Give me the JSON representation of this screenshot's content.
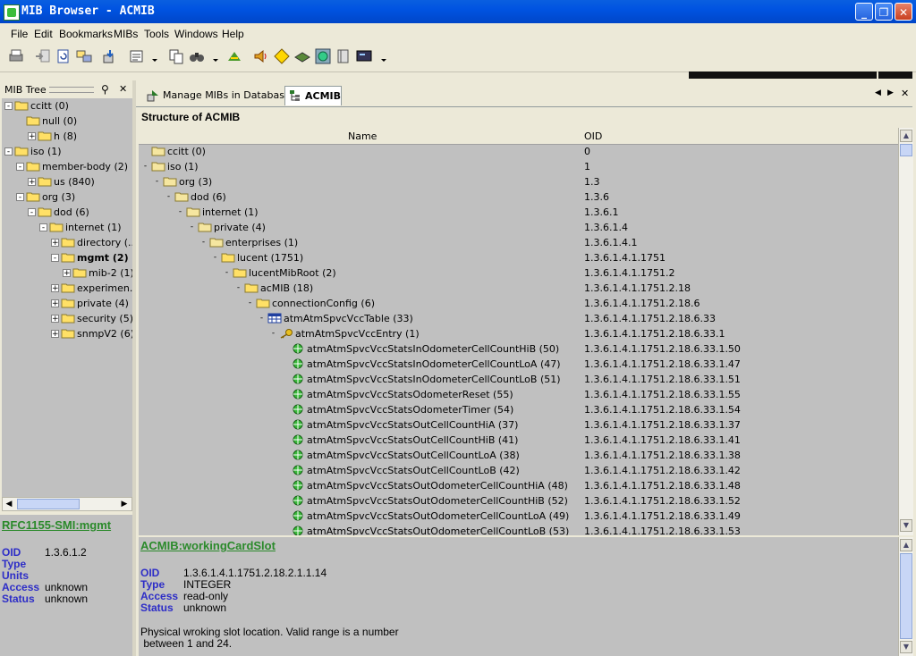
{
  "window": {
    "title": "MIB Browser - ACMIB",
    "minimize": "_",
    "maximize": "❐",
    "close": "✕"
  },
  "menu": [
    "File",
    "Edit",
    "Bookmarks",
    "MIBs",
    "Tools",
    "Windows",
    "Help"
  ],
  "toolbar_icons": [
    "printer-icon",
    "import-icon",
    "refresh-icon",
    "transfer-icon",
    "load-mib-icon",
    "properties-icon",
    "copy-icon",
    "find-icon",
    "walk-icon",
    "sound-icon",
    "tag-icon",
    "device-icon",
    "globe-icon",
    "book-icon",
    "screen-icon"
  ],
  "left": {
    "header": "MIB Tree",
    "pin": "⚲",
    "close": "✕",
    "tree": [
      {
        "label": "ccitt (0)",
        "depth": 0,
        "exp": "-"
      },
      {
        "label": "null (0)",
        "depth": 1,
        "exp": ""
      },
      {
        "label": "h (8)",
        "depth": 2,
        "exp": "+"
      },
      {
        "label": "iso (1)",
        "depth": 0,
        "exp": "-"
      },
      {
        "label": "member-body (2)",
        "depth": 1,
        "exp": "-"
      },
      {
        "label": "us (840)",
        "depth": 2,
        "exp": "+"
      },
      {
        "label": "org (3)",
        "depth": 1,
        "exp": "-"
      },
      {
        "label": "dod (6)",
        "depth": 2,
        "exp": "-"
      },
      {
        "label": "internet (1)",
        "depth": 3,
        "exp": "-"
      },
      {
        "label": "directory (...",
        "depth": 4,
        "exp": "+"
      },
      {
        "label": "mgmt (2)",
        "depth": 4,
        "exp": "-",
        "bold": true
      },
      {
        "label": "mib-2 (1)",
        "depth": 5,
        "exp": "+"
      },
      {
        "label": "experimen...",
        "depth": 4,
        "exp": "+"
      },
      {
        "label": "private (4)",
        "depth": 4,
        "exp": "+"
      },
      {
        "label": "security (5)",
        "depth": 4,
        "exp": "+"
      },
      {
        "label": "snmpV2 (6)",
        "depth": 4,
        "exp": "+"
      }
    ],
    "detail": {
      "title": "RFC1155-SMI:mgmt",
      "oid_label": "OID",
      "oid": "1.3.6.1.2",
      "type_label": "Type",
      "type": "",
      "units_label": "Units",
      "units": "",
      "access_label": "Access",
      "access": "unknown",
      "status_label": "Status",
      "status": "unknown"
    }
  },
  "tabs": [
    {
      "label": "Manage MIBs in Database"
    },
    {
      "label": "ACMIB"
    }
  ],
  "tab_nav": {
    "prev": "◀",
    "next": "▶",
    "close": "✕"
  },
  "structure_title": "Structure of ACMIB",
  "columns": {
    "name": "Name",
    "oid": "OID"
  },
  "rows": [
    {
      "name": "ccitt (0)",
      "oid": "0",
      "depth": 0,
      "icon": "folder",
      "exp": ""
    },
    {
      "name": "iso (1)",
      "oid": "1",
      "depth": 0,
      "icon": "folder",
      "exp": "-"
    },
    {
      "name": "org (3)",
      "oid": "1.3",
      "depth": 1,
      "icon": "folder",
      "exp": "-"
    },
    {
      "name": "dod (6)",
      "oid": "1.3.6",
      "depth": 2,
      "icon": "folder",
      "exp": "-"
    },
    {
      "name": "internet (1)",
      "oid": "1.3.6.1",
      "depth": 3,
      "icon": "folder",
      "exp": "-"
    },
    {
      "name": "private (4)",
      "oid": "1.3.6.1.4",
      "depth": 4,
      "icon": "folder",
      "exp": "-"
    },
    {
      "name": "enterprises (1)",
      "oid": "1.3.6.1.4.1",
      "depth": 5,
      "icon": "folder",
      "exp": "-"
    },
    {
      "name": "lucent (1751)",
      "oid": "1.3.6.1.4.1.1751",
      "depth": 6,
      "icon": "folder-open",
      "exp": "-"
    },
    {
      "name": "lucentMibRoot (2)",
      "oid": "1.3.6.1.4.1.1751.2",
      "depth": 7,
      "icon": "folder-open",
      "exp": "-"
    },
    {
      "name": "acMIB (18)",
      "oid": "1.3.6.1.4.1.1751.2.18",
      "depth": 8,
      "icon": "folder-open",
      "exp": "-"
    },
    {
      "name": "connectionConfig (6)",
      "oid": "1.3.6.1.4.1.1751.2.18.6",
      "depth": 9,
      "icon": "folder-open",
      "exp": "-"
    },
    {
      "name": "atmAtmSpvcVccTable (33)",
      "oid": "1.3.6.1.4.1.1751.2.18.6.33",
      "depth": 10,
      "icon": "table",
      "exp": "-"
    },
    {
      "name": "atmAtmSpvcVccEntry (1)",
      "oid": "1.3.6.1.4.1.1751.2.18.6.33.1",
      "depth": 11,
      "icon": "key",
      "exp": "-"
    },
    {
      "name": "atmAtmSpvcVccStatsInOdometerCellCountHiB (50)",
      "oid": "1.3.6.1.4.1.1751.2.18.6.33.1.50",
      "depth": 12,
      "icon": "leaf",
      "exp": ""
    },
    {
      "name": "atmAtmSpvcVccStatsInOdometerCellCountLoA (47)",
      "oid": "1.3.6.1.4.1.1751.2.18.6.33.1.47",
      "depth": 12,
      "icon": "leaf",
      "exp": ""
    },
    {
      "name": "atmAtmSpvcVccStatsInOdometerCellCountLoB (51)",
      "oid": "1.3.6.1.4.1.1751.2.18.6.33.1.51",
      "depth": 12,
      "icon": "leaf",
      "exp": ""
    },
    {
      "name": "atmAtmSpvcVccStatsOdometerReset (55)",
      "oid": "1.3.6.1.4.1.1751.2.18.6.33.1.55",
      "depth": 12,
      "icon": "leaf",
      "exp": ""
    },
    {
      "name": "atmAtmSpvcVccStatsOdometerTimer (54)",
      "oid": "1.3.6.1.4.1.1751.2.18.6.33.1.54",
      "depth": 12,
      "icon": "leaf",
      "exp": ""
    },
    {
      "name": "atmAtmSpvcVccStatsOutCellCountHiA (37)",
      "oid": "1.3.6.1.4.1.1751.2.18.6.33.1.37",
      "depth": 12,
      "icon": "leaf",
      "exp": ""
    },
    {
      "name": "atmAtmSpvcVccStatsOutCellCountHiB (41)",
      "oid": "1.3.6.1.4.1.1751.2.18.6.33.1.41",
      "depth": 12,
      "icon": "leaf",
      "exp": ""
    },
    {
      "name": "atmAtmSpvcVccStatsOutCellCountLoA (38)",
      "oid": "1.3.6.1.4.1.1751.2.18.6.33.1.38",
      "depth": 12,
      "icon": "leaf",
      "exp": ""
    },
    {
      "name": "atmAtmSpvcVccStatsOutCellCountLoB (42)",
      "oid": "1.3.6.1.4.1.1751.2.18.6.33.1.42",
      "depth": 12,
      "icon": "leaf",
      "exp": ""
    },
    {
      "name": "atmAtmSpvcVccStatsOutOdometerCellCountHiA (48)",
      "oid": "1.3.6.1.4.1.1751.2.18.6.33.1.48",
      "depth": 12,
      "icon": "leaf",
      "exp": ""
    },
    {
      "name": "atmAtmSpvcVccStatsOutOdometerCellCountHiB (52)",
      "oid": "1.3.6.1.4.1.1751.2.18.6.33.1.52",
      "depth": 12,
      "icon": "leaf",
      "exp": ""
    },
    {
      "name": "atmAtmSpvcVccStatsOutOdometerCellCountLoA (49)",
      "oid": "1.3.6.1.4.1.1751.2.18.6.33.1.49",
      "depth": 12,
      "icon": "leaf",
      "exp": ""
    },
    {
      "name": "atmAtmSpvcVccStatsOutOdometerCellCountLoB (53)",
      "oid": "1.3.6.1.4.1.1751.2.18.6.33.1.53",
      "depth": 12,
      "icon": "leaf",
      "exp": ""
    }
  ],
  "detail": {
    "title": "ACMIB:workingCardSlot",
    "oid_label": "OID",
    "oid": "1.3.6.1.4.1.1751.2.18.2.1.1.14",
    "type_label": "Type",
    "type": "INTEGER",
    "access_label": "Access",
    "access": "read-only",
    "status_label": "Status",
    "status": "unknown",
    "description_1": "Physical wroking slot location. Valid range is a number",
    "description_2": " between 1 and 24."
  },
  "colors": {
    "label_blue": "#2d2dc7",
    "link_green": "#2b8a2b",
    "tree_bg": "#c0c0c0"
  }
}
